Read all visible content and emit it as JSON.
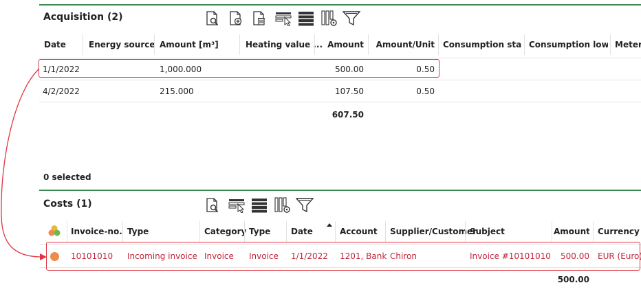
{
  "acquisition": {
    "title": "Acquisition (2)",
    "toolbar": [
      "view-details-icon",
      "add-document-icon",
      "delete-document-icon",
      "select-columns-icon",
      "list-view-icon",
      "column-settings-icon",
      "filter-icon"
    ],
    "columns": [
      "Date",
      "Energy source",
      "Amount [m³]",
      "Heating value ...",
      "Amount",
      "Amount/Unit",
      "Consumption sta...",
      "Consumption low...",
      "Meter"
    ],
    "rows": [
      {
        "date": "1/1/2022",
        "energy_source": "",
        "amount_m3": "1,000.000",
        "heating_value": "",
        "amount": "500.00",
        "amount_unit": "0.50"
      },
      {
        "date": "4/2/2022",
        "energy_source": "",
        "amount_m3": "215.000",
        "heating_value": "",
        "amount": "107.50",
        "amount_unit": "0.50"
      }
    ],
    "total_amount": "607.50",
    "selected_text": "0 selected"
  },
  "costs": {
    "title": "Costs (1)",
    "toolbar": [
      "view-details-icon",
      "select-columns-icon",
      "list-view-icon",
      "column-settings-icon",
      "filter-icon"
    ],
    "columns": [
      "",
      "Invoice-no.",
      "Type",
      "Category",
      "Type",
      "Date",
      "Account",
      "Supplier/Customer",
      "Subject",
      "Amount",
      "Currency"
    ],
    "sort_column": "Date",
    "rows": [
      {
        "status_color": "#ee8a4c",
        "invoice_no": "10101010",
        "type": "Incoming invoice",
        "category": "Invoice",
        "type2": "Invoice",
        "date": "1/1/2022",
        "account": "1201, Bank",
        "supplier": "Chiron",
        "subject": "Invoice #10101010",
        "amount": "500.00",
        "currency": "EUR (Euro)"
      }
    ],
    "total_amount": "500.00"
  },
  "colors": {
    "accent_green": "#3a8a4f",
    "highlight_red": "#e0343f",
    "row_text_red": "#c0243a"
  }
}
